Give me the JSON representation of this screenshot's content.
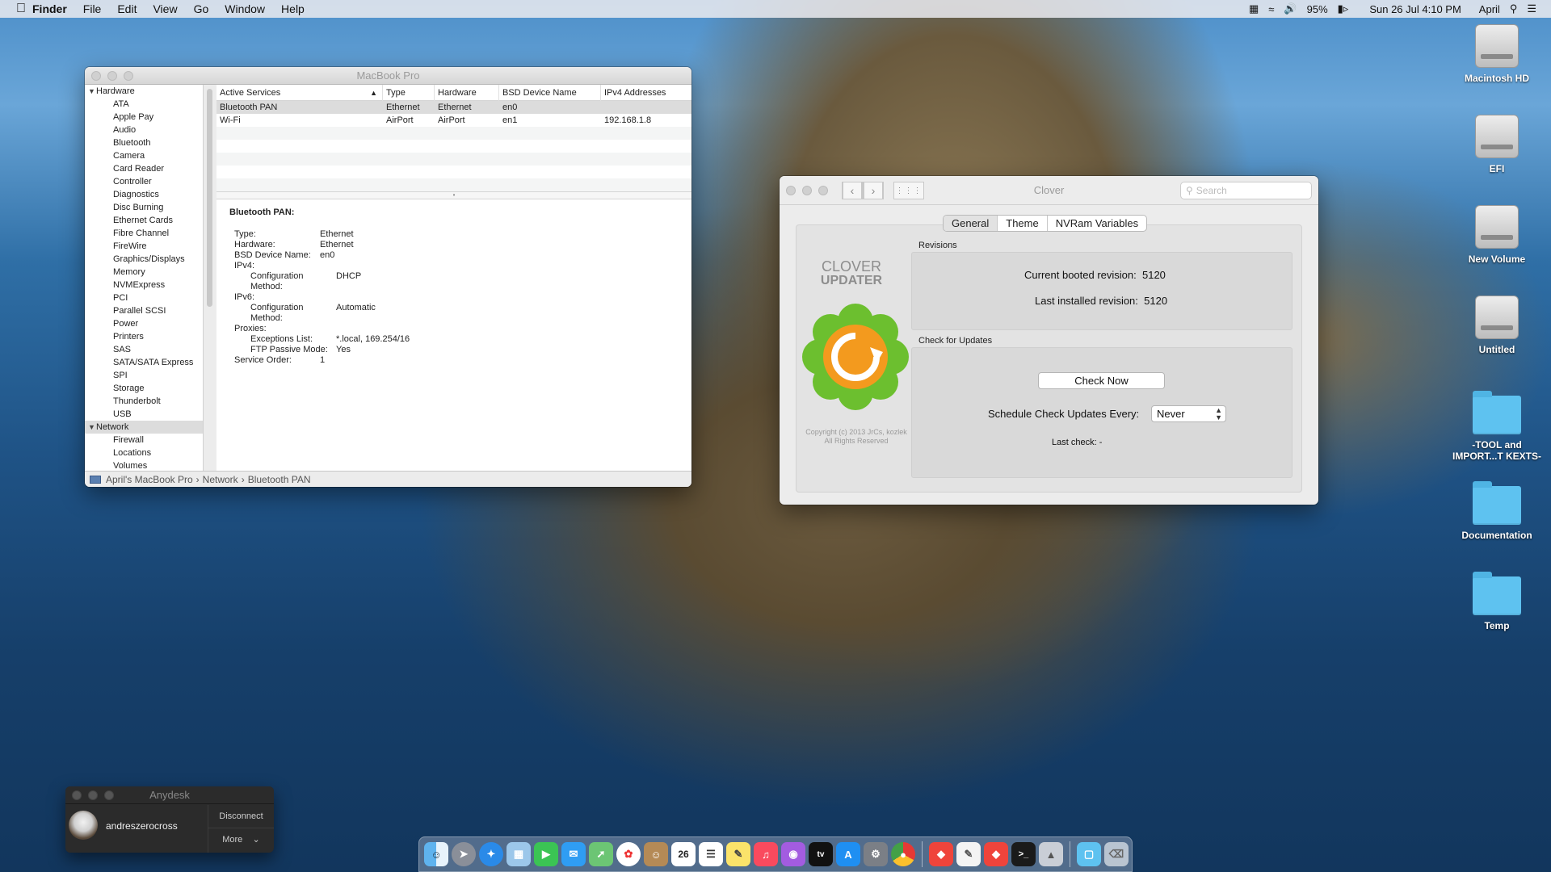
{
  "menubar": {
    "app_name": "Finder",
    "menus": [
      "File",
      "Edit",
      "View",
      "Go",
      "Window",
      "Help"
    ],
    "battery": "95%",
    "datetime": "Sun 26 Jul  4:10 PM",
    "user": "April"
  },
  "sysinfo": {
    "title": "MacBook Pro",
    "sidebar": {
      "hardware_label": "Hardware",
      "hardware_items": [
        "ATA",
        "Apple Pay",
        "Audio",
        "Bluetooth",
        "Camera",
        "Card Reader",
        "Controller",
        "Diagnostics",
        "Disc Burning",
        "Ethernet Cards",
        "Fibre Channel",
        "FireWire",
        "Graphics/Displays",
        "Memory",
        "NVMExpress",
        "PCI",
        "Parallel SCSI",
        "Power",
        "Printers",
        "SAS",
        "SATA/SATA Express",
        "SPI",
        "Storage",
        "Thunderbolt",
        "USB"
      ],
      "network_label": "Network",
      "network_items": [
        "Firewall",
        "Locations",
        "Volumes"
      ]
    },
    "table": {
      "columns": [
        "Active Services",
        "Type",
        "Hardware",
        "BSD Device Name",
        "IPv4 Addresses"
      ],
      "rows": [
        [
          "Bluetooth PAN",
          "Ethernet",
          "Ethernet",
          "en0",
          ""
        ],
        [
          "Wi-Fi",
          "AirPort",
          "AirPort",
          "en1",
          "192.168.1.8"
        ]
      ]
    },
    "detail": {
      "heading": "Bluetooth PAN:",
      "type_k": "Type:",
      "type_v": "Ethernet",
      "hw_k": "Hardware:",
      "hw_v": "Ethernet",
      "bsd_k": "BSD Device Name:",
      "bsd_v": "en0",
      "ipv4_k": "IPv4:",
      "ipv4_cfg_k": "Configuration Method:",
      "ipv4_cfg_v": "DHCP",
      "ipv6_k": "IPv6:",
      "ipv6_cfg_k": "Configuration Method:",
      "ipv6_cfg_v": "Automatic",
      "proxies_k": "Proxies:",
      "exc_k": "Exceptions List:",
      "exc_v": "*.local, 169.254/16",
      "ftp_k": "FTP Passive Mode:",
      "ftp_v": "Yes",
      "order_k": "Service Order:",
      "order_v": "1"
    },
    "pathbar": [
      "April's MacBook Pro",
      "Network",
      "Bluetooth PAN"
    ]
  },
  "clover": {
    "title": "Clover",
    "search_placeholder": "Search",
    "tabs": [
      "General",
      "Theme",
      "NVRam Variables"
    ],
    "logo_line1": "CLOVER",
    "logo_line2": "UPDATER",
    "copyright_1": "Copyright (c) 2013 JrCs, kozlek",
    "copyright_2": "All Rights Reserved",
    "revisions_label": "Revisions",
    "booted_label": "Current booted revision:",
    "booted_value": "5120",
    "installed_label": "Last installed revision:",
    "installed_value": "5120",
    "check_label": "Check for Updates",
    "check_now": "Check Now",
    "schedule_label": "Schedule Check Updates Every:",
    "schedule_value": "Never",
    "last_check": "Last check: -"
  },
  "desktop_icons": [
    "Macintosh HD",
    "EFI",
    "New Volume",
    "Untitled",
    "-TOOL and IMPORT...T KEXTS-",
    "Documentation",
    "Temp"
  ],
  "anydesk": {
    "title": "Anydesk",
    "username": "andreszerocross",
    "disconnect": "Disconnect",
    "more": "More"
  },
  "dock": {
    "calendar_day": "26"
  },
  "colors": {
    "clover_orange": "#f39a1e",
    "clover_green": "#6cbf2f",
    "folder_blue": "#5ec2f0"
  }
}
